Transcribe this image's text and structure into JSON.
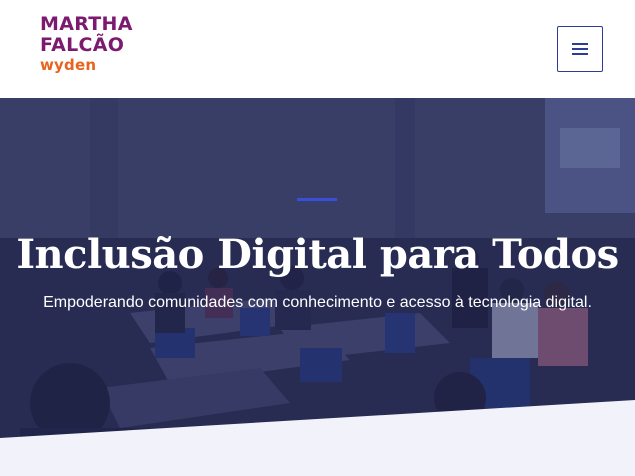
{
  "brand": {
    "line1": "MARTHA",
    "line2": "FALCÃO",
    "sub": "wyden",
    "primary_color": "#7b1a6e",
    "accent_color": "#e8641e"
  },
  "nav": {
    "menu_icon": "hamburger-icon",
    "button_color": "#2e3b97"
  },
  "hero": {
    "title": "Inclusão Digital para Todos",
    "subtitle": "Empoderando comunidades com conhecimento e acesso à tecnologia digital.",
    "accent_color": "#3a4fd8",
    "bottom_band_color": "#f2f2fb"
  }
}
